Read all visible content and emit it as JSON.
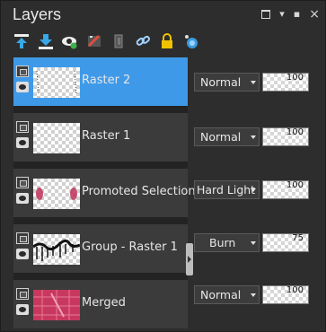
{
  "panel": {
    "title": "Layers",
    "controls": [
      "dock-icon",
      "pin-icon",
      "menu-icon",
      "close-icon"
    ],
    "close_label": "×"
  },
  "toolbar": {
    "tools": [
      "new-raster-layer-icon",
      "new-adjustment-layer-icon",
      "visibility-eye-icon",
      "mask-icon",
      "duplicate-layer-icon",
      "link-icon",
      "lock-icon",
      "settings-icon"
    ]
  },
  "layers": [
    {
      "name": "Raster 2",
      "blend": "Normal",
      "opacity": "100",
      "selected": true
    },
    {
      "name": "Raster 1",
      "blend": "Normal",
      "opacity": "100",
      "selected": false
    },
    {
      "name": "Promoted Selection",
      "blend": "Hard Light",
      "opacity": "100",
      "selected": false
    },
    {
      "name": "Group - Raster 1",
      "blend": "Burn",
      "opacity": "75",
      "selected": false
    },
    {
      "name": "Merged",
      "blend": "Normal",
      "opacity": "100",
      "selected": false
    }
  ],
  "colors": {
    "selected": "#3e9ae8",
    "background": "#2d2d2d",
    "row": "#3b3b3b"
  }
}
